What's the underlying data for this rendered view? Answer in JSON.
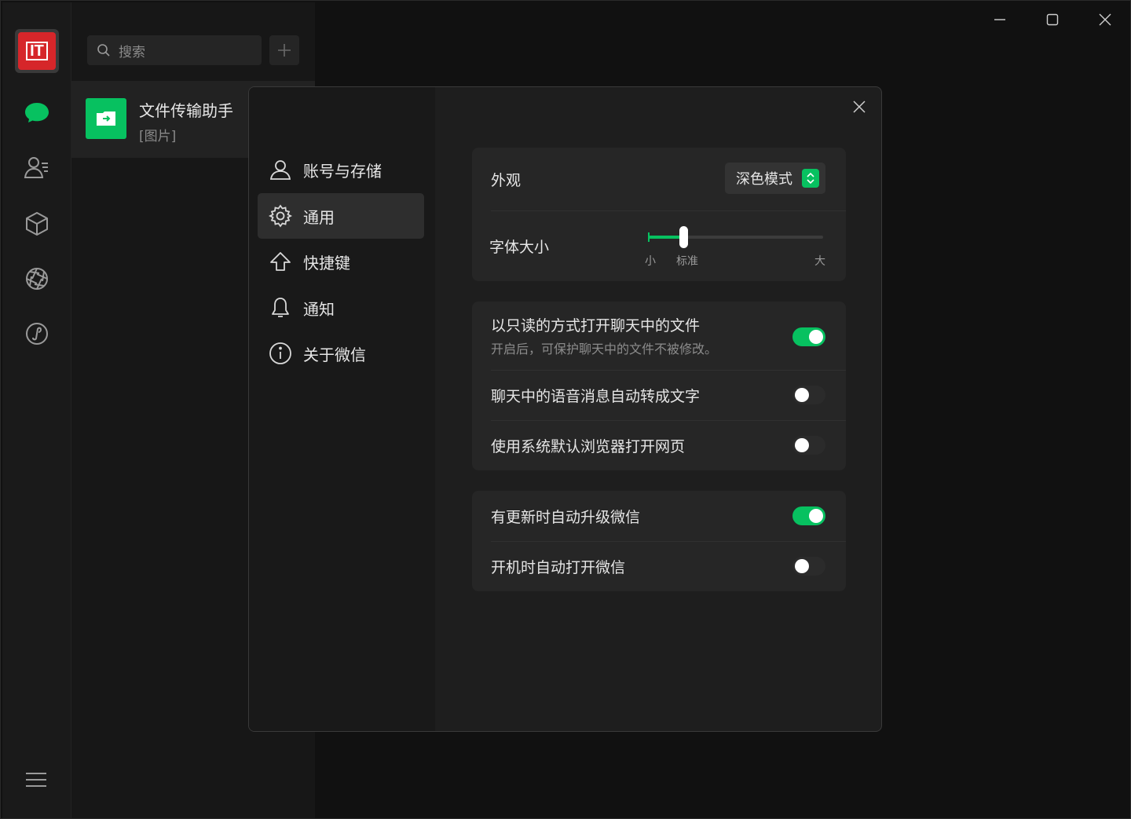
{
  "colors": {
    "accent": "#07c160",
    "bg": "#111111",
    "dialog_bg": "#1e1e1e",
    "card_bg": "#262626",
    "brand_red": "#d6262a"
  },
  "rail": {
    "avatar_text": "IT",
    "icons": [
      "chat-icon",
      "contacts-icon",
      "box-icon",
      "aperture-icon",
      "mini-program-icon",
      "menu-icon"
    ]
  },
  "chatlist": {
    "search_placeholder": "搜索",
    "items": [
      {
        "title": "文件传输助手",
        "subtitle": "[图片]",
        "icon": "file-transfer-icon"
      }
    ]
  },
  "settings": {
    "nav": [
      {
        "label": "账号与存储",
        "icon": "user-icon",
        "active": false
      },
      {
        "label": "通用",
        "icon": "gear-icon",
        "active": true
      },
      {
        "label": "快捷键",
        "icon": "arrow-up-icon",
        "active": false
      },
      {
        "label": "通知",
        "icon": "bell-icon",
        "active": false
      },
      {
        "label": "关于微信",
        "icon": "info-icon",
        "active": false
      }
    ],
    "appearance": {
      "label": "外观",
      "value": "深色模式"
    },
    "font_size": {
      "label": "字体大小",
      "min_label": "小",
      "standard_label": "标准",
      "max_label": "大",
      "level": 0.2
    },
    "group1": [
      {
        "title": "以只读的方式打开聊天中的文件",
        "subtitle": "开启后，可保护聊天中的文件不被修改。",
        "on": true
      },
      {
        "title": "聊天中的语音消息自动转成文字",
        "on": false
      },
      {
        "title": "使用系统默认浏览器打开网页",
        "on": false
      }
    ],
    "group2": [
      {
        "title": "有更新时自动升级微信",
        "on": true
      },
      {
        "title": "开机时自动打开微信",
        "on": false
      }
    ]
  }
}
